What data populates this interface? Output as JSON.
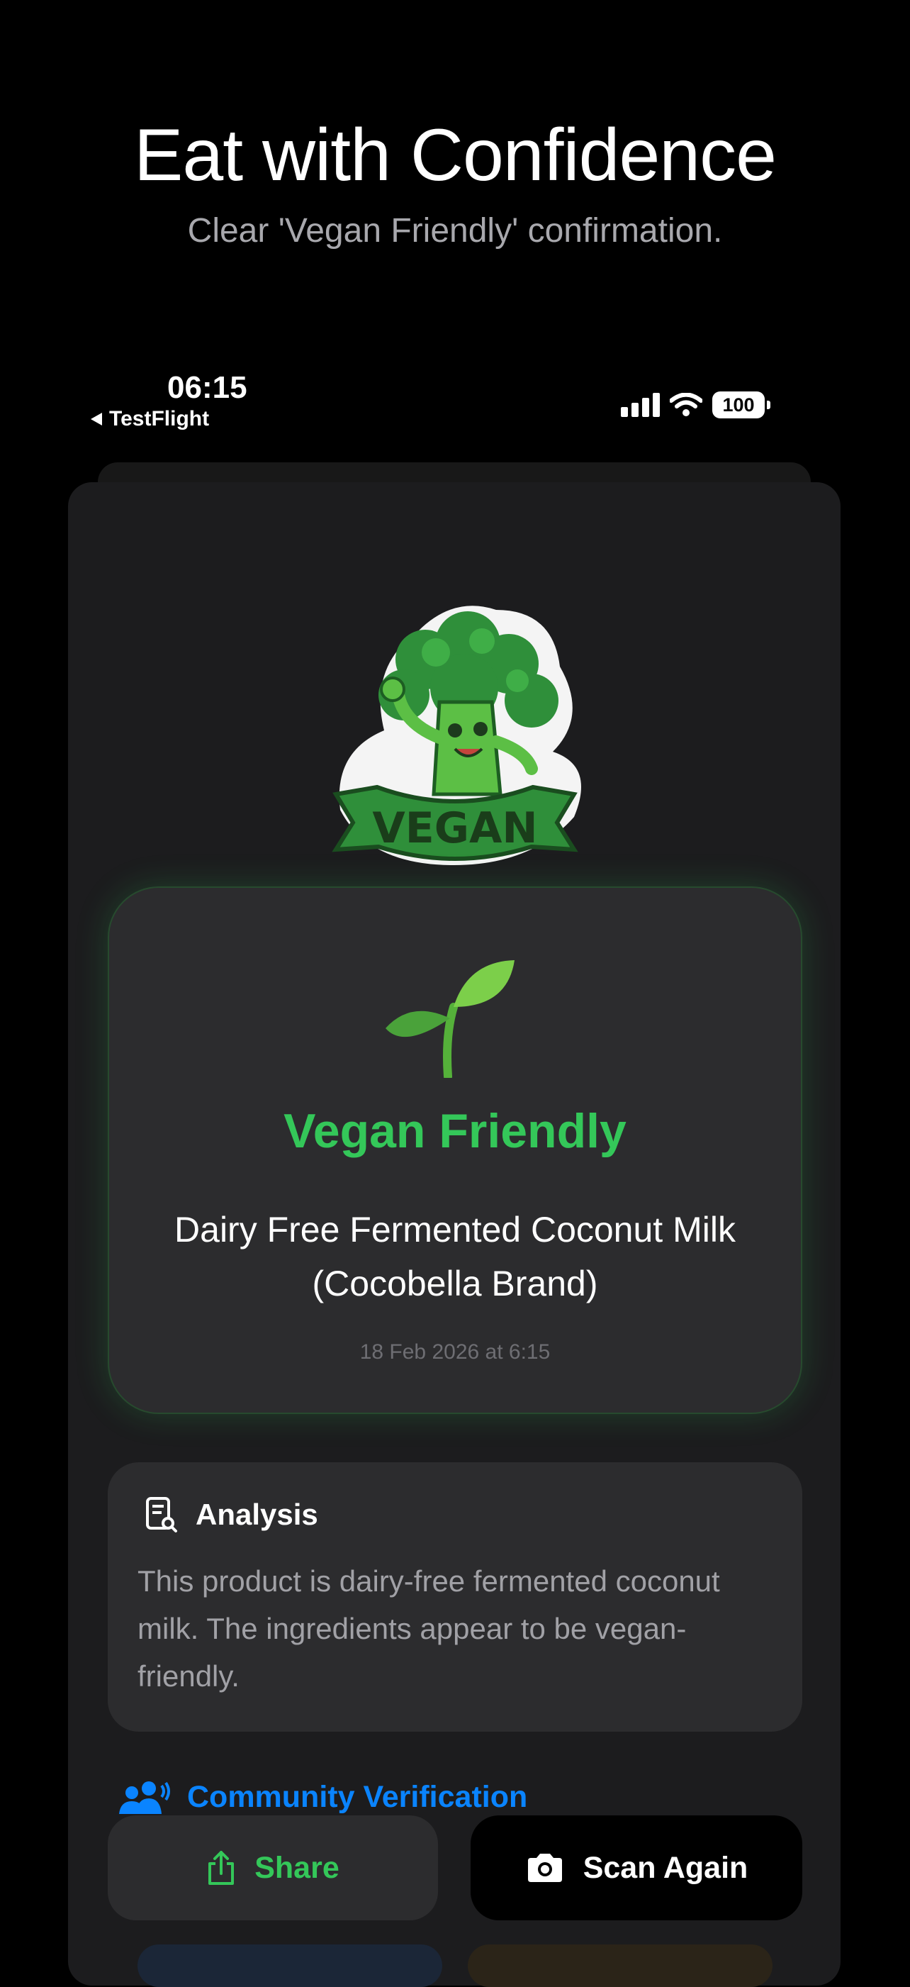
{
  "marketing": {
    "headline": "Eat with Confidence",
    "subheadline": "Clear 'Vegan Friendly' confirmation."
  },
  "status_bar": {
    "time": "06:15",
    "back_app": "TestFlight",
    "battery": "100",
    "icons": [
      "signal-icon",
      "wifi-icon",
      "battery-icon"
    ]
  },
  "result": {
    "sticker_text": "VEGAN",
    "status_icon": "sprout-icon",
    "status": "Vegan Friendly",
    "status_color": "#34c759",
    "product_name": "Dairy Free Fermented Coconut Milk (Cocobella Brand)",
    "date": "18 Feb 2026 at 6:15"
  },
  "analysis": {
    "title": "Analysis",
    "text": "This product is dairy-free fermented coconut milk. The ingredients appear to be vegan-friendly."
  },
  "community": {
    "title": "Community Verification",
    "color": "#0a84ff"
  },
  "actions": {
    "share_label": "Share",
    "scan_again_label": "Scan Again"
  }
}
